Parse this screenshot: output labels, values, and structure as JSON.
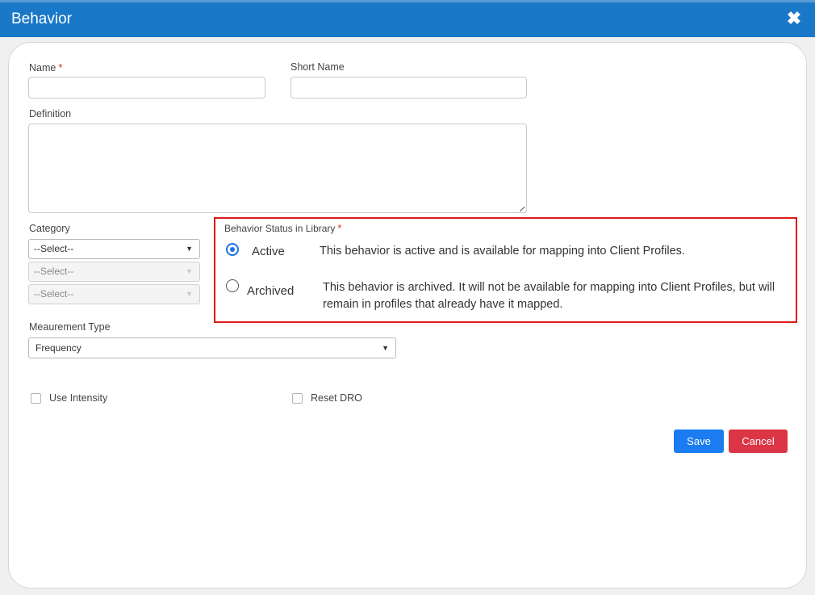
{
  "dialog": {
    "title": "Behavior",
    "close_glyph": "✖"
  },
  "form": {
    "name_label": "Name",
    "name_value": "",
    "short_name_label": "Short Name",
    "short_name_value": "",
    "definition_label": "Definition",
    "definition_value": "",
    "required_mark": "*",
    "category_label": "Category",
    "category_selects": [
      "--Select--",
      "--Select--",
      "--Select--"
    ],
    "measurement_label": "Meaurement Type",
    "measurement_value": "Frequency",
    "status": {
      "label": "Behavior Status in Library",
      "options": [
        {
          "label": "Active",
          "checked": true,
          "description": "This behavior is active and is available for mapping into Client Profiles."
        },
        {
          "label": "Archived",
          "checked": false,
          "description": "This behavior is archived. It will not be available for mapping into Client Profiles, but will remain in profiles that already have it mapped."
        }
      ]
    },
    "use_intensity_label": "Use Intensity",
    "reset_dro_label": "Reset DRO"
  },
  "actions": {
    "save_label": "Save",
    "cancel_label": "Cancel"
  },
  "colors": {
    "titlebar": "#1a78c8",
    "save": "#1a7cf0",
    "cancel": "#dc3545",
    "highlight_border": "#e01818",
    "radio_checked": "#1a73e8"
  }
}
